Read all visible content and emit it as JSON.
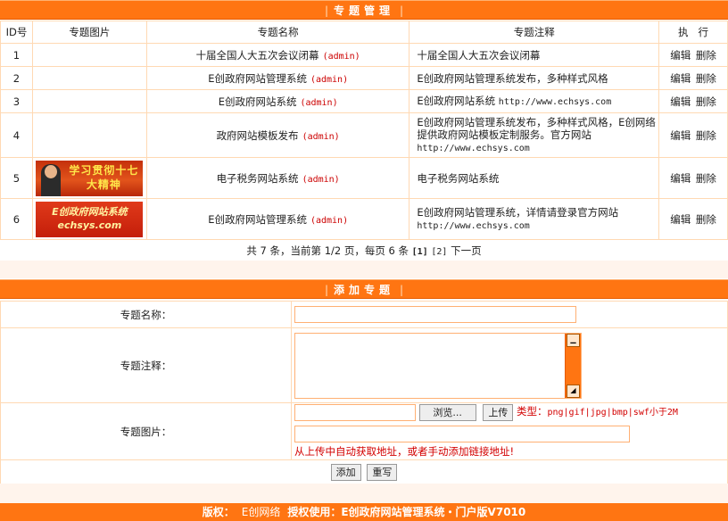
{
  "manage_header": "专题管理",
  "columns": [
    "ID号",
    "专题图片",
    "专题名称",
    "专题注释",
    "执   行"
  ],
  "rows": [
    {
      "id": "1",
      "name": "十届全国人大五次会议闭幕",
      "author": "(admin)",
      "note": "十届全国人大五次会议闭幕",
      "note_url": "",
      "image": ""
    },
    {
      "id": "2",
      "name": "E创政府网站管理系统",
      "author": "(admin)",
      "note": "E创政府网站管理系统发布，多种样式风格",
      "note_url": "",
      "image": ""
    },
    {
      "id": "3",
      "name": "E创政府网站系统",
      "author": "(admin)",
      "note": "E创政府网站系统",
      "note_url": "http://www.echsys.com",
      "image": ""
    },
    {
      "id": "4",
      "name": "政府网站模板发布",
      "author": "(admin)",
      "note": "E创政府网站管理系统发布，多种样式风格，E创网络提供政府网站模板定制服务。官方网站",
      "note_url": "http://www.echsys.com",
      "image": ""
    },
    {
      "id": "5",
      "name": "电子税务网站系统",
      "author": "(admin)",
      "note": "电子税务网站系统",
      "note_url": "",
      "image": "学习贯彻十七大精神"
    },
    {
      "id": "6",
      "name": "E创政府网站管理系统",
      "author": "(admin)",
      "note": "E创政府网站管理系统，详情请登录官方网站",
      "note_url": "http://www.echsys.com",
      "image": "E创政府网站系统 echsys.com"
    }
  ],
  "actions": {
    "edit": "编辑",
    "delete": "删除"
  },
  "pager": {
    "text": "共 7 条，当前第 1/2 页，每页 6 条",
    "page1": "[1]",
    "page2": "[2]",
    "next": "下一页"
  },
  "add_header": "添加专题",
  "form": {
    "name_label": "专题名称：",
    "note_label": "专题注释：",
    "image_label": "专题图片：",
    "browse": "浏览...",
    "upload": "上传",
    "type_label": "类型：",
    "types": "png|gif|jpg|bmp|swf小于2M",
    "hint": "从上传中自动获取地址，或者手动添加链接地址!",
    "add": "添加",
    "reset": "重写"
  },
  "footer": {
    "copyright": "版权：",
    "company": "E创网络",
    "license": "授权使用：E创政府网站管理系统・门户版V7010"
  },
  "colors": {
    "accent": "#ff7512",
    "border": "#ffd9b3",
    "red": "#cc0000"
  }
}
